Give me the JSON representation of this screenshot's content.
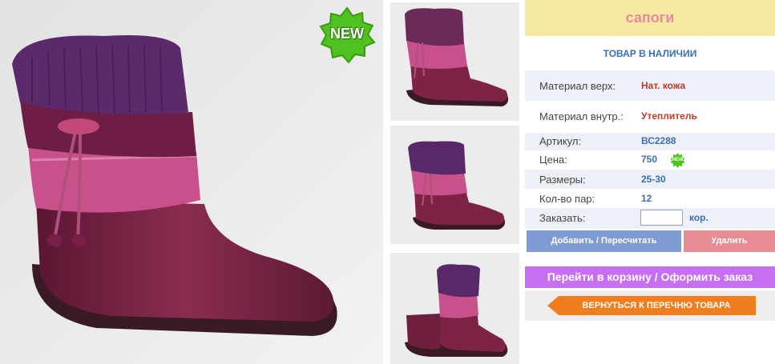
{
  "product": {
    "title": "сапоги",
    "stock_status": "ТОВАР В НАЛИЧИИ",
    "badge_text": "NEW"
  },
  "details": {
    "material_top": {
      "label": "Материал верх:",
      "value": "Нат. кожа"
    },
    "material_in": {
      "label": "Материал внутр.:",
      "value": "Утеплитель"
    },
    "article": {
      "label": "Артикул:",
      "value": "ВС2288"
    },
    "price": {
      "label": "Цена:",
      "value": "750",
      "badge": "NEW"
    },
    "sizes": {
      "label": "Размеры:",
      "value": "25-30"
    },
    "pairs": {
      "label": "Кол-во пар:",
      "value": "12"
    },
    "order": {
      "label": "Заказать:",
      "quantity": "",
      "unit": "кор."
    }
  },
  "actions": {
    "add_label": "Добавить / Пересчитать",
    "delete_label": "Удалить",
    "cart_label": "Перейти в корзину / Оформить заказ",
    "back_label": "ВЕРНУТЬСЯ К ПЕРЕЧНЮ ТОВАРА"
  },
  "colors": {
    "title_bg": "#f7eaa0",
    "title_text": "#e8899e",
    "accent_blue": "#3a6fb3",
    "accent_red": "#c0392b",
    "add_button": "#7f9ad4",
    "delete_button": "#e78b95",
    "cart_button": "#c66ff0",
    "back_button": "#f07d1e",
    "badge_green": "#4fc21f"
  },
  "icons": {
    "main_badge": "new-starburst-icon",
    "price_badge": "new-starburst-icon",
    "back_arrow": "arrow-left-icon"
  }
}
